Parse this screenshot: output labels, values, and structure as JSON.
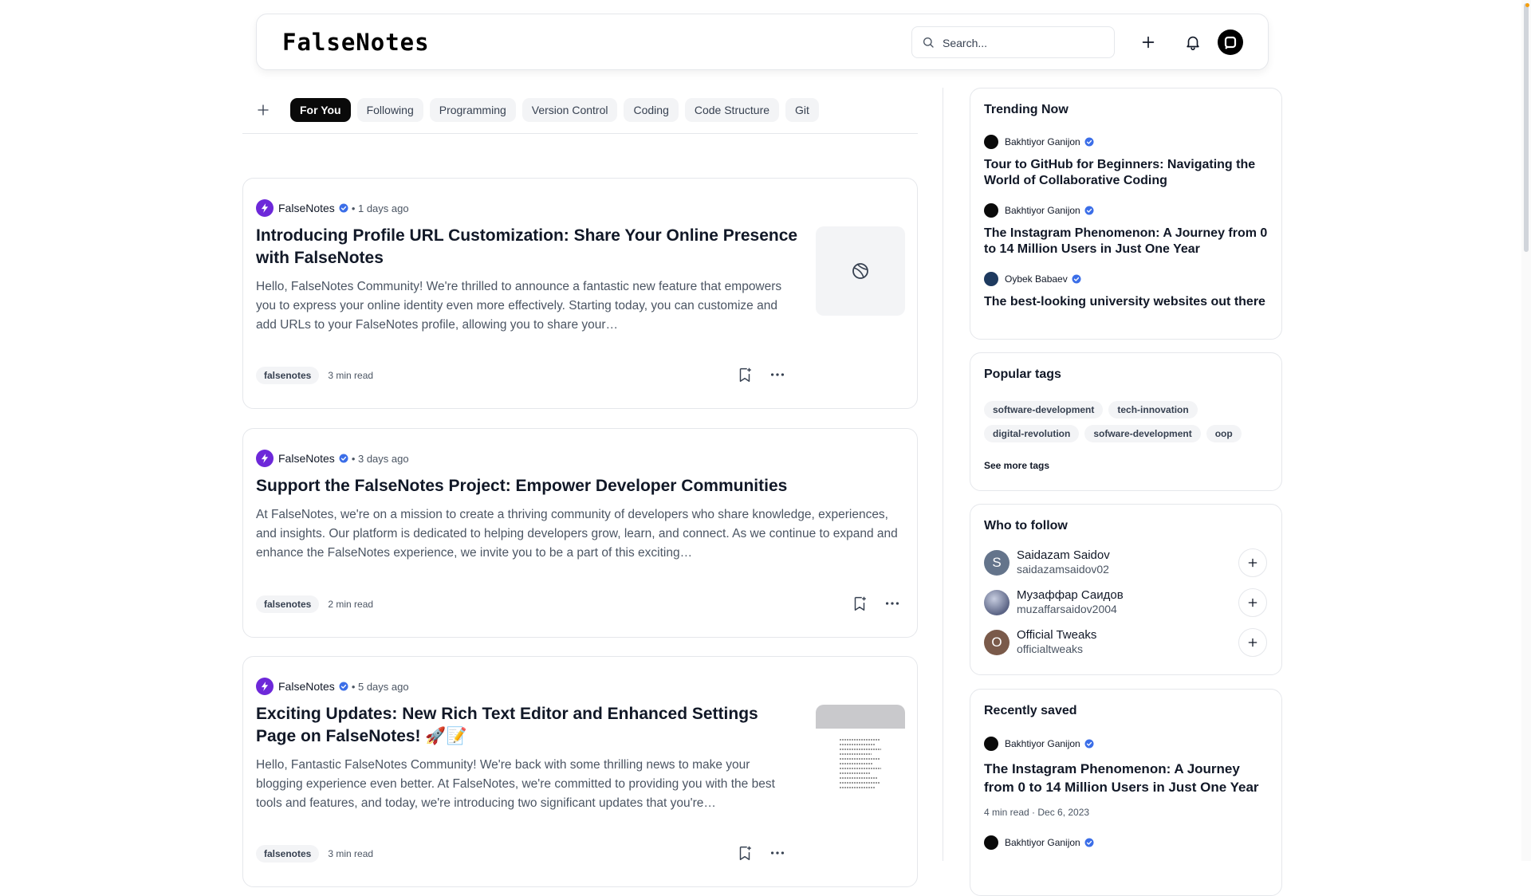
{
  "header": {
    "logo_text": "FalseNotes",
    "search": {
      "placeholder": "Search..."
    },
    "icons": [
      "search-icon",
      "plus-icon",
      "bell-icon",
      "avatar"
    ]
  },
  "tabs": [
    "For You",
    "Following",
    "Programming",
    "Version Control",
    "Coding",
    "Code Structure",
    "Git"
  ],
  "active_tab": "For You",
  "posts": [
    {
      "author": "FalseNotes",
      "time": "• 1 days ago",
      "title": "Introducing Profile URL Customization: Share Your Online Presence with FalseNotes",
      "excerpt": "Hello, FalseNotes Community! We're thrilled to announce a fantastic new feature that empowers you to express your online identity even more effectively. Starting today, you can customize and add URLs to your FalseNotes profile, allowing you to share your…",
      "tag": "falsenotes",
      "read_time": "3 min read",
      "thumbnail": "placeholder-icon"
    },
    {
      "author": "FalseNotes",
      "time": "• 3 days ago",
      "title": "Support the FalseNotes Project: Empower Developer Communities",
      "excerpt": "At FalseNotes, we're on a mission to create a thriving community of developers who share knowledge, experiences, and insights. Our platform is dedicated to helping developers grow, learn, and connect. As we continue to expand and enhance the FalseNotes experience, we invite you to be a part of this exciting…",
      "tag": "falsenotes",
      "read_time": "2 min read",
      "thumbnail": ""
    },
    {
      "author": "FalseNotes",
      "time": "• 5 days ago",
      "title": "Exciting Updates: New Rich Text Editor and Enhanced Settings Page on FalseNotes! 🚀📝",
      "excerpt": "Hello, Fantastic FalseNotes Community! We're back with some thrilling news to make your blogging experience even better. At FalseNotes, we're committed to providing you with the best tools and features, and today, we're introducing two significant updates that you're…",
      "tag": "falsenotes",
      "read_time": "3 min read",
      "thumbnail": "screenshot-image"
    }
  ],
  "trending": {
    "title": "Trending Now",
    "items": [
      {
        "author": "Bakhtiyor Ganijon",
        "title": "Tour to GitHub for Beginners: Navigating the World of Collaborative Coding"
      },
      {
        "author": "Bakhtiyor Ganijon",
        "title": "The Instagram Phenomenon: A Journey from 0 to 14 Million Users in Just One Year"
      },
      {
        "author": "Oybek Babaev",
        "title": "The best-looking university websites out there"
      }
    ]
  },
  "popular_tags": {
    "title": "Popular tags",
    "tags": [
      "software-development",
      "tech-innovation",
      "digital-revolution",
      "sofware-development",
      "oop"
    ],
    "see_more": "See more tags"
  },
  "who_to_follow": {
    "title": "Who to follow",
    "users": [
      {
        "initial": "S",
        "name": "Saidazam Saidov",
        "handle": "saidazamsaidov02",
        "color": "#64748b"
      },
      {
        "initial": "",
        "name": "Музаффар Саидов",
        "handle": "muzaffarsaidov2004",
        "color": "#7c86a8"
      },
      {
        "initial": "O",
        "name": "Official Tweaks",
        "handle": "officialtweaks",
        "color": "#7a5a4a"
      }
    ]
  },
  "recently_saved": {
    "title": "Recently saved",
    "items": [
      {
        "author": "Bakhtiyor Ganijon",
        "title": "The Instagram Phenomenon: A Journey from 0 to 14 Million Users in Just One Year",
        "meta": "4 min read · Dec 6, 2023"
      },
      {
        "author": "Bakhtiyor Ganijon"
      }
    ]
  },
  "colors": {
    "brand": "#6d28d9",
    "active_tab": "#0a0a0a",
    "verified": "#3b6ee8"
  }
}
